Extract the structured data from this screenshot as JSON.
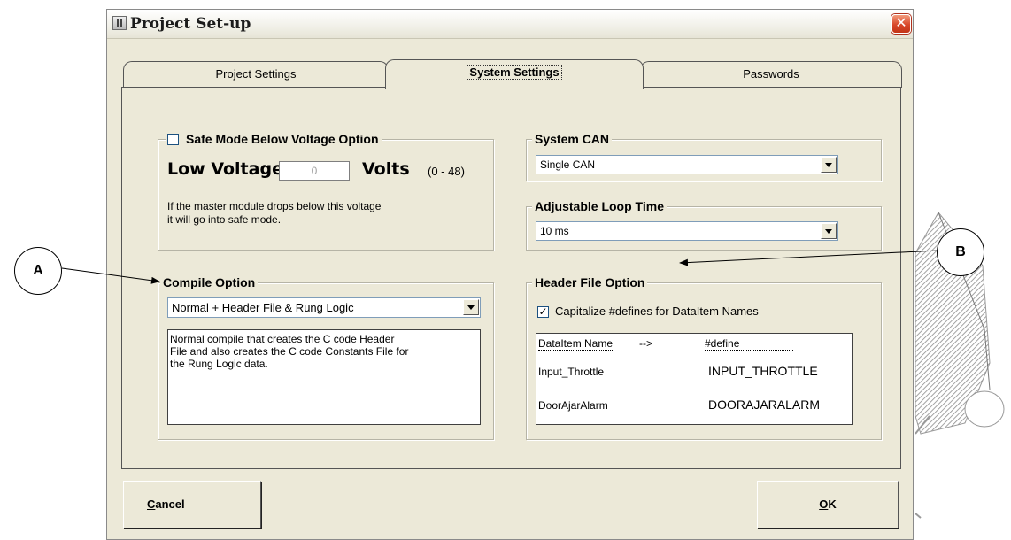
{
  "window": {
    "title": "Project Set-up",
    "close_glyph": "✕"
  },
  "tabs": [
    {
      "label": "Project Settings",
      "active": false
    },
    {
      "label": "System Settings",
      "active": true
    },
    {
      "label": "Passwords",
      "active": false
    }
  ],
  "safe_mode": {
    "label": "Safe Mode Below Voltage Option",
    "checked": false,
    "low_voltage_label": "Low Voltage:",
    "low_voltage_value": "0",
    "unit": "Volts",
    "range": "(0 - 48)",
    "description_line1": "If the master module drops below this voltage",
    "description_line2": "it will go into safe mode."
  },
  "system_can": {
    "label": "System CAN",
    "selected": "Single CAN"
  },
  "loop_time": {
    "label": "Adjustable Loop Time",
    "selected": "10 ms"
  },
  "compile_option": {
    "label": "Compile Option",
    "selected": "Normal + Header File & Rung Logic",
    "description_line1": "Normal compile that creates the C code Header",
    "description_line2": "File and also creates the C code Constants File for",
    "description_line3": "the Rung Logic data."
  },
  "header_file_option": {
    "label": "Header File Option",
    "checkbox_label": "Capitalize #defines for DataItem Names",
    "checked": true,
    "check_glyph": "✓",
    "preview": {
      "col1_header": "DataItem Name",
      "arrow": "-->",
      "col2_header": "#define",
      "rows": [
        {
          "name": "Input_Throttle",
          "define": "INPUT_THROTTLE"
        },
        {
          "name": "DoorAjarAlarm",
          "define": "DOORAJARALARM"
        }
      ]
    }
  },
  "buttons": {
    "cancel_prefix": "C",
    "cancel_rest": "ancel",
    "ok_prefix": "O",
    "ok_rest": "K"
  },
  "callouts": {
    "a": "A",
    "b": "B"
  }
}
